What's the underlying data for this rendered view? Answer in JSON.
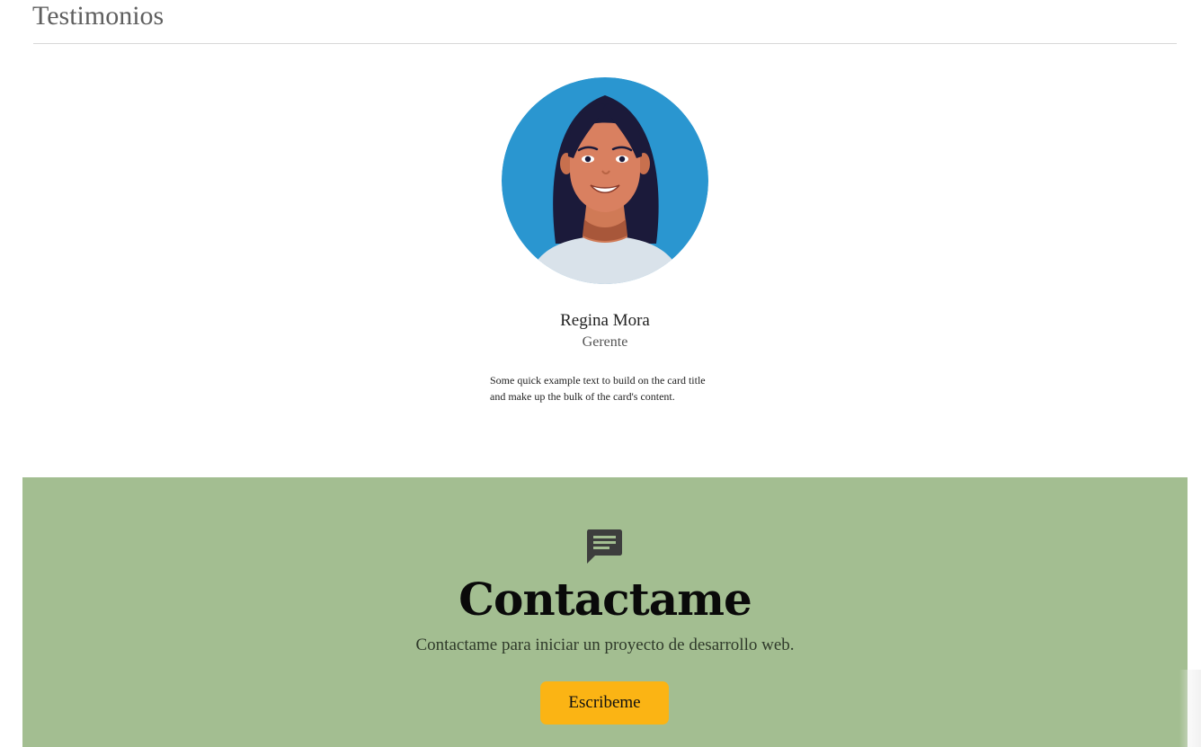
{
  "testimonials": {
    "heading": "Testimonios",
    "items": [
      {
        "name": "Regina Mora",
        "role": "Gerente",
        "quote": "Some quick example text to build on the card title and make up the bulk of the card's content."
      }
    ]
  },
  "contact": {
    "icon": "chat-message-icon",
    "title": "Contactame",
    "subtitle": "Contactame para iniciar un proyecto de desarrollo web.",
    "button_label": "Escribeme"
  },
  "colors": {
    "contact_background": "#a3be91",
    "button_background": "#fbb414",
    "avatar_background": "#2a96d0"
  }
}
